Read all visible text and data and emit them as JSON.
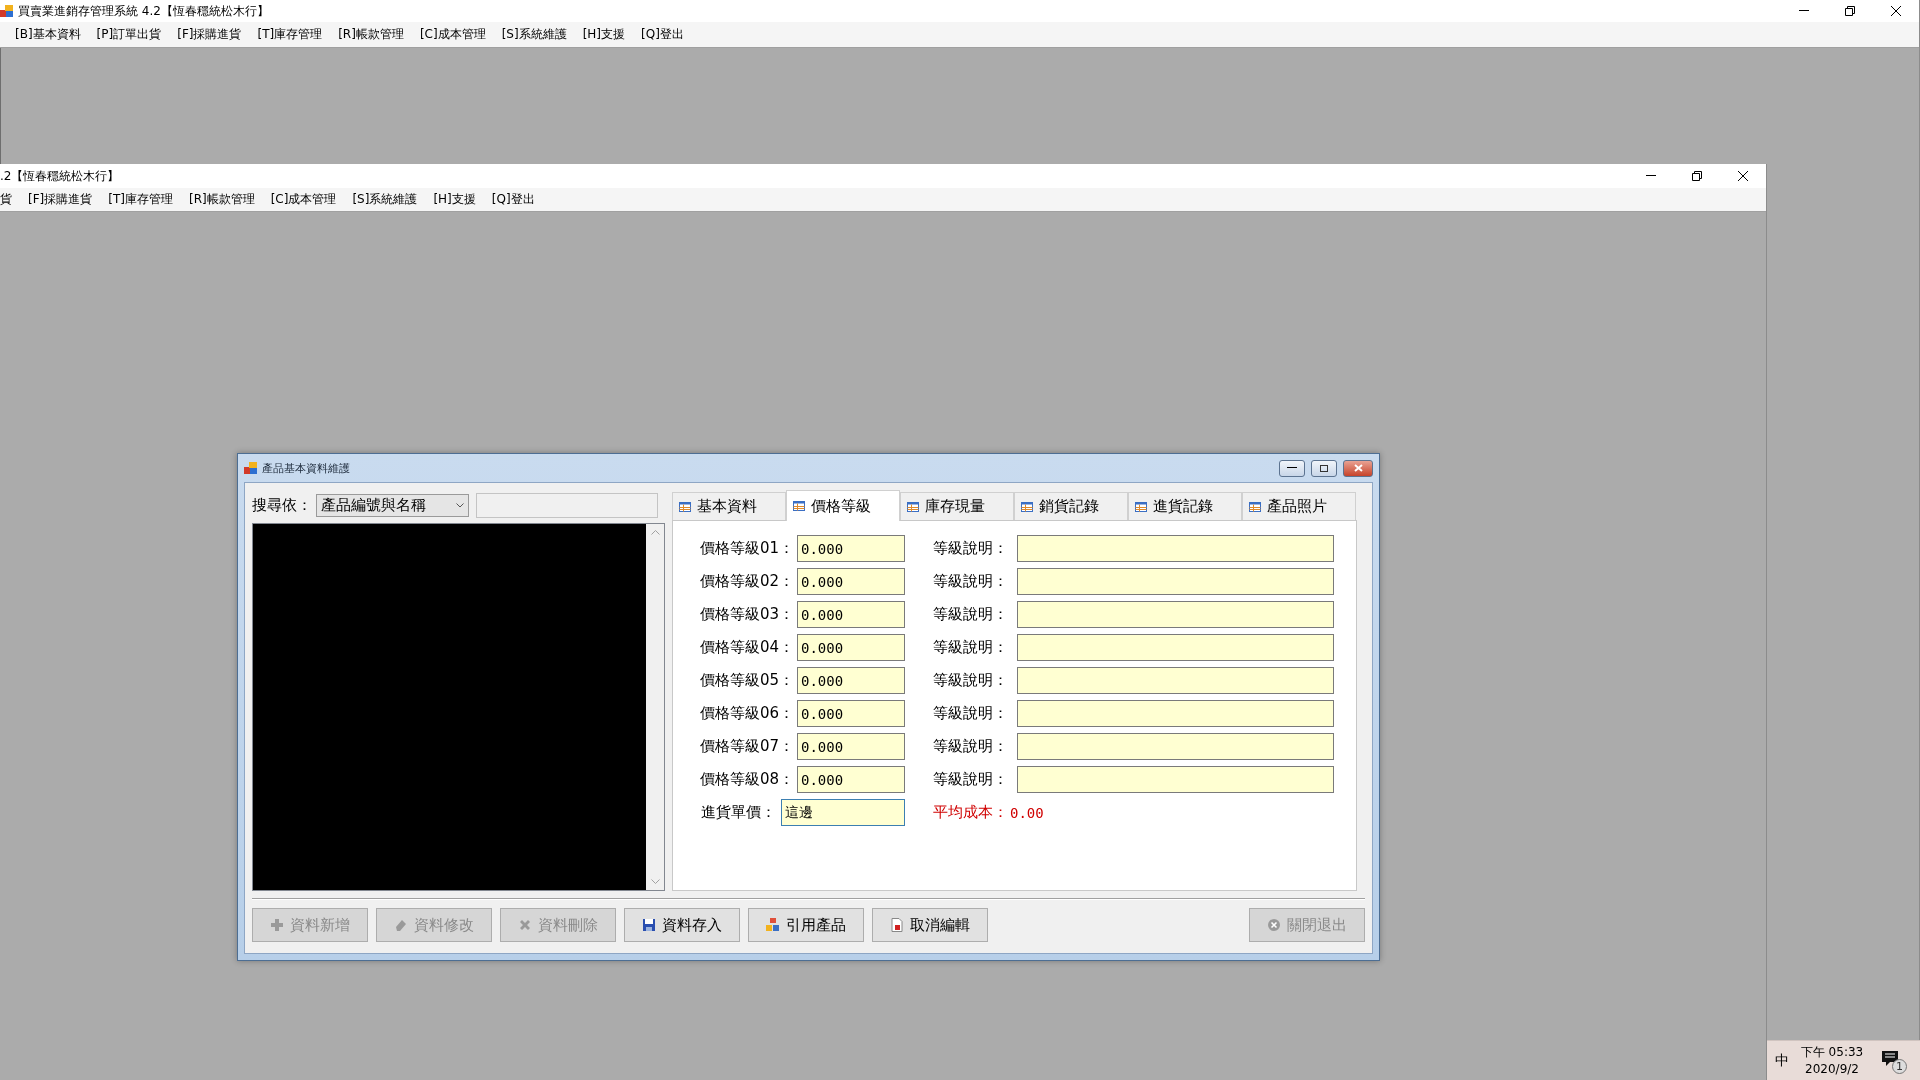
{
  "main_window": {
    "title": "買賣業進銷存管理系統 4.2【恆春穩統松木行】",
    "menu": [
      "[B]基本資料",
      "[P]訂單出貨",
      "[F]採購進貨",
      "[T]庫存管理",
      "[R]帳款管理",
      "[C]成本管理",
      "[S]系統維護",
      "[H]支援",
      "[Q]登出"
    ]
  },
  "child_window": {
    "title": ".2【恆春穩統松木行】",
    "menu": [
      "貨",
      "[F]採購進貨",
      "[T]庫存管理",
      "[R]帳款管理",
      "[C]成本管理",
      "[S]系統維護",
      "[H]支援",
      "[Q]登出"
    ]
  },
  "dialog": {
    "title": "產品基本資料維護",
    "search": {
      "label": "搜尋依：",
      "mode": "產品編號與名稱"
    },
    "tabs": [
      {
        "label": "基本資料",
        "selected": false
      },
      {
        "label": "價格等級",
        "selected": true
      },
      {
        "label": "庫存現量",
        "selected": false
      },
      {
        "label": "銷貨記錄",
        "selected": false
      },
      {
        "label": "進貨記錄",
        "selected": false
      },
      {
        "label": "產品照片",
        "selected": false
      }
    ],
    "price_levels": [
      {
        "label": "價格等級01：",
        "value": "0.000",
        "note_label": "等級說明："
      },
      {
        "label": "價格等級02：",
        "value": "0.000",
        "note_label": "等級說明："
      },
      {
        "label": "價格等級03：",
        "value": "0.000",
        "note_label": "等級說明："
      },
      {
        "label": "價格等級04：",
        "value": "0.000",
        "note_label": "等級說明："
      },
      {
        "label": "價格等級05：",
        "value": "0.000",
        "note_label": "等級說明："
      },
      {
        "label": "價格等級06：",
        "value": "0.000",
        "note_label": "等級說明："
      },
      {
        "label": "價格等級07：",
        "value": "0.000",
        "note_label": "等級說明："
      },
      {
        "label": "價格等級08：",
        "value": "0.000",
        "note_label": "等級說明："
      }
    ],
    "purchase_price": {
      "label": "進貨單價：",
      "value": "這邊"
    },
    "average_cost": {
      "label": "平均成本：",
      "value": "0.00"
    },
    "buttons": [
      {
        "kind": "add",
        "label": "資料新增",
        "disabled": true
      },
      {
        "kind": "edit",
        "label": "資料修改",
        "disabled": true
      },
      {
        "kind": "delete",
        "label": "資料刪除",
        "disabled": true
      },
      {
        "kind": "save",
        "label": "資料存入",
        "disabled": false
      },
      {
        "kind": "reference",
        "label": "引用產品",
        "disabled": false
      },
      {
        "kind": "cancel",
        "label": "取消編輯",
        "disabled": false
      },
      {
        "kind": "close",
        "label": "關閉退出",
        "disabled": true
      }
    ]
  },
  "taskbar": {
    "input_method": "中",
    "time": "下午 05:33",
    "date": "2020/9/2",
    "notifications": "1"
  }
}
